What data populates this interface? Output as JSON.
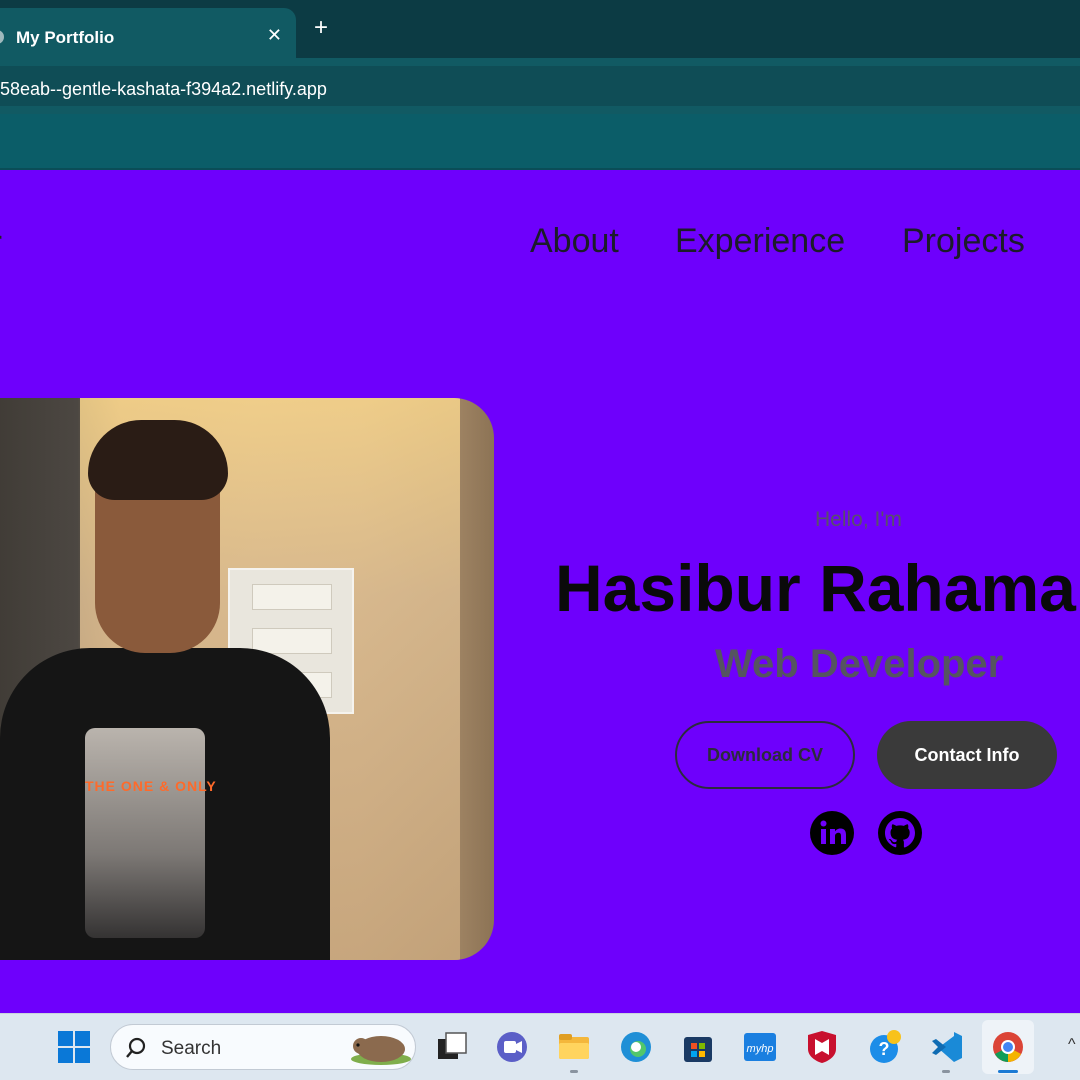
{
  "browser": {
    "tab_title": "My Portfolio",
    "tab_close": "✕",
    "new_tab": "+",
    "url": "58eab--gentle-kashata-f394a2.netlify.app"
  },
  "page": {
    "logo_fragment": "r",
    "nav": {
      "about": "About",
      "experience": "Experience",
      "projects": "Projects"
    },
    "hero": {
      "greeting": "Hello, I'm",
      "name": "Hasibur Rahaman",
      "role": "Web Developer",
      "download_cv": "Download CV",
      "contact_info": "Contact Info"
    },
    "photo_shirt_text": "THE ONE & ONLY",
    "social": [
      "linkedin-icon",
      "github-icon"
    ]
  },
  "taskbar": {
    "search_placeholder": "Search",
    "apps": [
      "windows-start-icon",
      "task-view-icon",
      "meet-icon",
      "file-explorer-icon",
      "edge-icon",
      "store-icon",
      "myhp-icon",
      "mcafee-icon",
      "help-icon",
      "vscode-icon",
      "chrome-icon"
    ]
  },
  "colors": {
    "page_bg": "#6e00fc",
    "tab_bg": "#115a63",
    "button_dark": "#3a3a3a"
  }
}
